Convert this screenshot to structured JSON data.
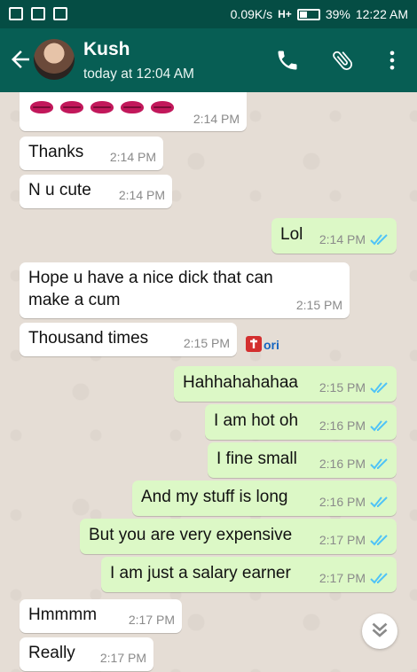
{
  "statusbar": {
    "speed": "0.09K/s",
    "signal": "H+",
    "battery": "39%",
    "time": "12:22 AM",
    "icons": [
      "notification-icon",
      "image-icon",
      "message-icon"
    ]
  },
  "header": {
    "contact_name": "Kush",
    "last_seen": "today at 12:04 AM",
    "icons": [
      "back-arrow-icon",
      "phone-icon",
      "paperclip-icon",
      "more-vert-icon"
    ]
  },
  "colors": {
    "header": "#075e54",
    "statusbar": "#054d44",
    "incoming_bubble": "#ffffff",
    "outgoing_bubble": "#dcf8c6",
    "read_ticks": "#4fc3f7",
    "chat_background": "#e5ddd5"
  },
  "messages": [
    {
      "direction": "in",
      "emoji": "lips x5",
      "time": "2:14 PM"
    },
    {
      "direction": "in",
      "text": "Thanks",
      "time": "2:14 PM"
    },
    {
      "direction": "in",
      "text": "N u cute",
      "time": "2:14 PM"
    },
    {
      "direction": "out",
      "text": "Lol",
      "time": "2:14 PM",
      "status": "read"
    },
    {
      "direction": "in",
      "text_line1": "Hope u have a nice dick that can",
      "text_line2": "make a cum",
      "time": "2:15 PM"
    },
    {
      "direction": "in",
      "text": "Thousand times",
      "time": "2:15 PM"
    },
    {
      "direction": "out",
      "text": "Hahhahahahaa",
      "time": "2:15 PM",
      "status": "read"
    },
    {
      "direction": "out",
      "text": "I am hot oh",
      "time": "2:16 PM",
      "status": "read"
    },
    {
      "direction": "out",
      "text": "I fine small",
      "time": "2:16 PM",
      "status": "read"
    },
    {
      "direction": "out",
      "text": "And my stuff is long",
      "time": "2:16 PM",
      "status": "read"
    },
    {
      "direction": "out",
      "text": "But you are very expensive",
      "time": "2:17 PM",
      "status": "read"
    },
    {
      "direction": "out",
      "text": "I am just a salary earner",
      "time": "2:17 PM",
      "status": "read"
    },
    {
      "direction": "in",
      "text": "Hmmmm",
      "time": "2:17 PM"
    },
    {
      "direction": "in",
      "text": "Really",
      "time": "2:17 PM"
    }
  ],
  "watermark": {
    "text": "ori"
  },
  "scroll_button": {
    "icon": "double-chevron-down-icon"
  }
}
